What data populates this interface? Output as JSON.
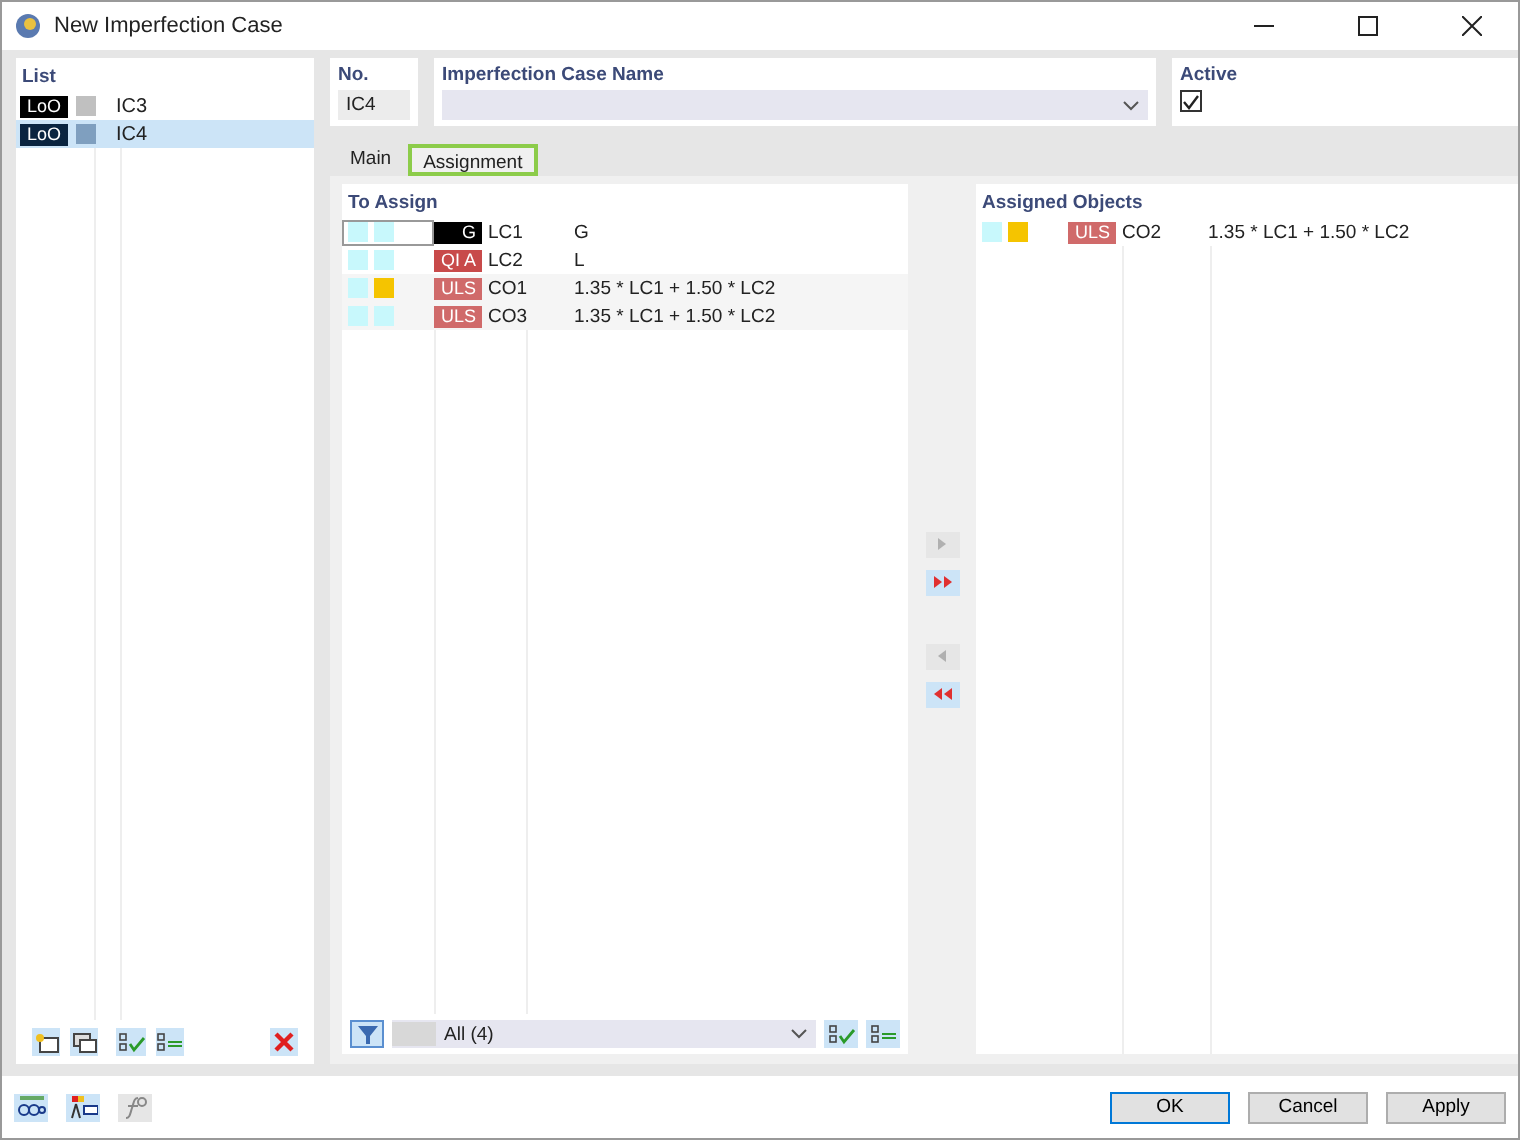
{
  "window": {
    "title": "New Imperfection Case"
  },
  "list": {
    "title": "List",
    "items": [
      {
        "tag": "LoO",
        "color": "#c0c0c0",
        "name": "IC3",
        "selected": false
      },
      {
        "tag": "LoO",
        "color": "#7f9fbf",
        "name": "IC4",
        "selected": true
      }
    ]
  },
  "number": {
    "label": "No.",
    "value": "IC4"
  },
  "case_name": {
    "label": "Imperfection Case Name"
  },
  "active": {
    "label": "Active",
    "checked": true
  },
  "tabs": [
    {
      "label": "Main",
      "selected": false
    },
    {
      "label": "Assignment",
      "selected": true
    }
  ],
  "to_assign": {
    "title": "To Assign",
    "rows": [
      {
        "swatches": [
          {
            "color": "#c8f8fc"
          },
          {
            "color": "#c8f8fc"
          }
        ],
        "tag": {
          "label": "G",
          "color": "#000000"
        },
        "name": "LC1",
        "description": "G",
        "selected": true
      },
      {
        "swatches": [
          {
            "color": "#c8f8fc"
          },
          {
            "color": "#c8f8fc"
          }
        ],
        "tag": {
          "label": "QI A",
          "color": "#c84a4a"
        },
        "name": "LC2",
        "description": "L",
        "selected": false
      },
      {
        "swatches": [
          {
            "color": "#c8f8fc"
          },
          {
            "color": "#f5c400"
          }
        ],
        "tag": {
          "label": "ULS",
          "color": "#d06a6a"
        },
        "name": "CO1",
        "description": "1.35 * LC1 + 1.50 * LC2",
        "selected": false
      },
      {
        "swatches": [
          {
            "color": "#c8f8fc"
          },
          {
            "color": "#c8f8fc"
          }
        ],
        "tag": {
          "label": "ULS",
          "color": "#d06a6a"
        },
        "name": "CO3",
        "description": "1.35 * LC1 + 1.50 * LC2",
        "selected": false
      }
    ],
    "filter": "All (4)"
  },
  "transfer_buttons": [
    {
      "kind": "one-right",
      "disabled": true
    },
    {
      "kind": "all-right",
      "disabled": false
    },
    {
      "kind": "one-left",
      "disabled": true
    },
    {
      "kind": "all-left",
      "disabled": false
    }
  ],
  "assigned": {
    "title": "Assigned Objects",
    "rows": [
      {
        "swatches": [
          {
            "color": "#c8f8fc"
          },
          {
            "color": "#f5c400"
          }
        ],
        "tag": {
          "label": "ULS",
          "color": "#d06a6a"
        },
        "name": "CO2",
        "description": "1.35 * LC1 + 1.50 * LC2",
        "selected": false
      }
    ]
  },
  "buttons": [
    {
      "label": "OK",
      "default": true
    },
    {
      "label": "Cancel",
      "default": false
    },
    {
      "label": "Apply",
      "default": false
    }
  ]
}
